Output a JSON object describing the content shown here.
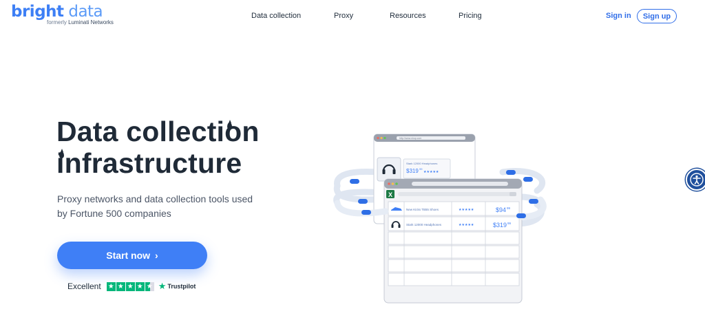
{
  "brand": {
    "name_part1": "bright",
    "name_part2": " data",
    "tagline_prefix": "formerly",
    "tagline_name": "Luminati Networks"
  },
  "nav": {
    "items": [
      {
        "label": "Data collection"
      },
      {
        "label": "Proxy"
      },
      {
        "label": "Resources"
      },
      {
        "label": "Pricing"
      }
    ],
    "sign_in": "Sign in",
    "sign_up": "Sign up"
  },
  "hero": {
    "title_line1": "Data collection",
    "title_line2": "infrastructure",
    "subtitle": "Proxy networks and data collection tools used by Fortune 500 companies",
    "cta_label": "Start now",
    "cta_icon": "chevron-right-icon"
  },
  "trustpilot": {
    "rating_text": "Excellent",
    "stars": 4.5,
    "brand": "Trustpilot"
  },
  "illustration": {
    "back_window": {
      "url": "http://www.shop.com",
      "product": "Stark 12000 Headphones",
      "price": "$319",
      "price_cents": "99"
    },
    "front_window": {
      "app": "Excel",
      "rows": [
        {
          "product": "New Kicks TB55 Shoes",
          "rating": "★★★★★",
          "price": "$94",
          "price_cents": "99"
        },
        {
          "product": "Stark 12000 Headphones",
          "rating": "★★★★★",
          "price": "$319",
          "price_cents": "99"
        }
      ]
    }
  },
  "colors": {
    "accent": "#3f7ff6",
    "brand_blue": "#3d7ff5",
    "heading": "#1f2a37",
    "trustpilot_green": "#00b67a",
    "accessibility_button": "#1f4f9c"
  }
}
